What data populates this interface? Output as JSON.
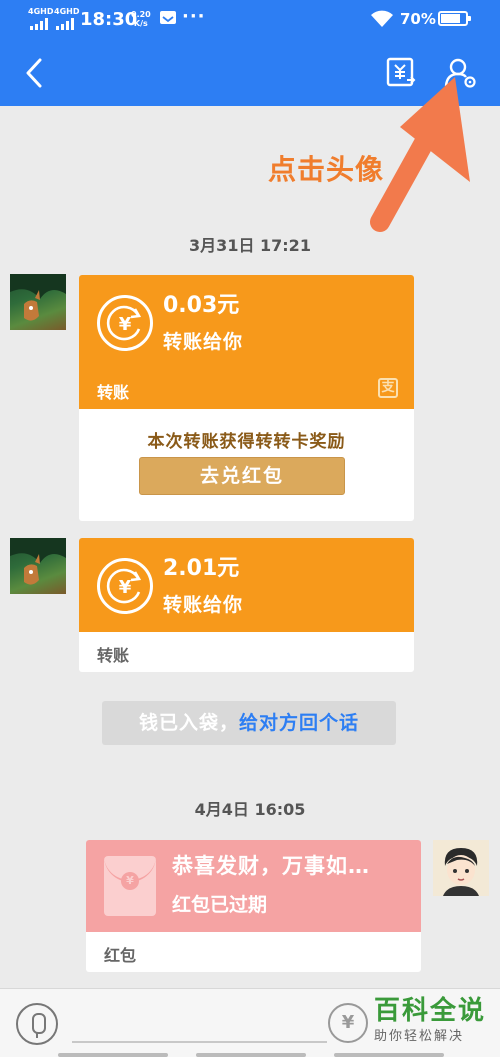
{
  "status_bar": {
    "net1": "4GHD",
    "net2": "4GHD",
    "time": "18:30",
    "speed_value": "0.20",
    "speed_unit": "K/s",
    "more": "···",
    "battery": "70%"
  },
  "nav": {
    "back_icon": "back-arrow-icon",
    "transfer_icon": "transfer-record-icon",
    "profile_icon": "profile-settings-icon"
  },
  "annotation": {
    "text": "点击头像",
    "color": "#f07d2d"
  },
  "messages": {
    "timestamp1": "3月31日 17:21",
    "transfer1": {
      "amount": "0.03元",
      "desc": "转账给你",
      "label": "转账",
      "reward_text": "本次转账获得转转卡奖励",
      "redeem_button": "去兑红包"
    },
    "transfer2": {
      "amount": "2.01元",
      "desc": "转账给你",
      "label": "转账"
    },
    "tip": {
      "text": "钱已入袋，",
      "link": "给对方回个话"
    },
    "timestamp2": "4月4日 16:05",
    "red_packet": {
      "title": "恭喜发财，万事如…",
      "subtitle": "红包已过期",
      "label": "红包"
    }
  },
  "yuan_symbol": "¥",
  "badge_char": "支",
  "watermark": {
    "title": "百科全说",
    "subtitle": "助你轻松解决"
  },
  "colors": {
    "brand_blue": "#2d7ef3",
    "transfer_orange": "#f7991b",
    "red_packet_pink": "#f5a3a3",
    "button_gold": "#dba95c"
  }
}
